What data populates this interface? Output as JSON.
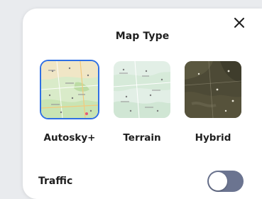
{
  "dialog": {
    "title": "Map Type",
    "close_icon": "close-icon"
  },
  "map_types": [
    {
      "label": "Autosky+",
      "selected": true
    },
    {
      "label": "Terrain",
      "selected": false
    },
    {
      "label": "Hybrid",
      "selected": false
    }
  ],
  "traffic": {
    "label": "Traffic",
    "enabled": false
  },
  "colors": {
    "selected_outline": "#2f6fe4",
    "toggle_track": "#6b7490"
  }
}
